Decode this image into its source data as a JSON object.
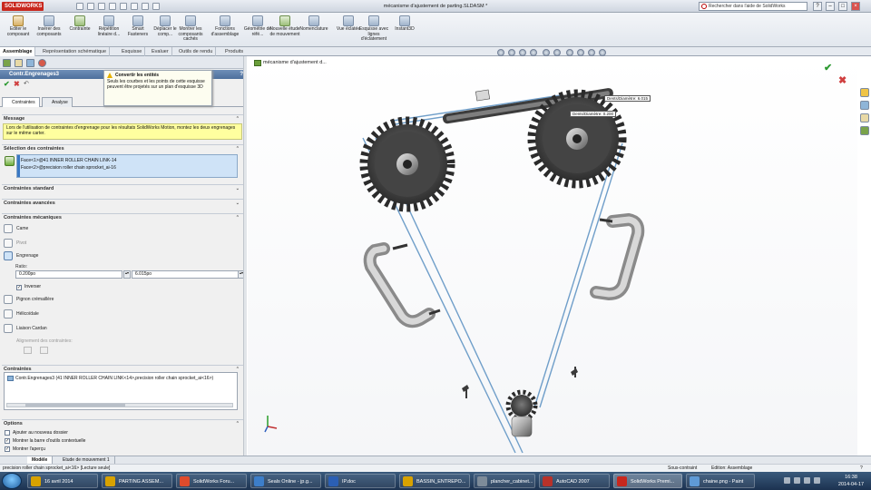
{
  "app": {
    "logo": "SOLIDWORKS",
    "window_title": "mécanisme d'ajustement de parting.SLDASM *",
    "help_search_placeholder": "Rechercher dans l'aide de SolidWorks"
  },
  "command_manager": {
    "buttons": [
      {
        "label": "Editer le composant",
        "icon": "edit-component-icon"
      },
      {
        "label": "Insérer des composants",
        "icon": "insert-components-icon"
      },
      {
        "label": "Contrainte",
        "icon": "mate-icon"
      },
      {
        "label": "Répétition linéaire d...",
        "icon": "linear-pattern-icon"
      },
      {
        "label": "Smart Fasteners",
        "icon": "smart-fasteners-icon"
      },
      {
        "label": "Déplacer le comp...",
        "icon": "move-component-icon"
      },
      {
        "label": "Montrer les composants cachés",
        "icon": "show-hidden-icon"
      },
      {
        "label": "Fonctions d'assemblage",
        "icon": "assembly-features-icon"
      },
      {
        "label": "Géométrie de réfé...",
        "icon": "reference-geometry-icon"
      },
      {
        "label": "Nouvelle étude de mouvement",
        "icon": "motion-study-icon"
      },
      {
        "label": "Nomenclature",
        "icon": "bom-icon"
      },
      {
        "label": "Vue éclatée",
        "icon": "exploded-view-icon"
      },
      {
        "label": "Esquisse avec lignes d'éclatement",
        "icon": "explode-line-icon"
      },
      {
        "label": "Instant3D",
        "icon": "instant3d-icon"
      }
    ]
  },
  "tabs": [
    "Assemblage",
    "Représentation schématique",
    "Esquisse",
    "Evaluer",
    "Outils de rendu",
    "Produits Office"
  ],
  "property_manager": {
    "title": "Contr.Engrenages3",
    "help": "?",
    "subtabs": [
      "Contraintes",
      "Analyse"
    ],
    "message_header": "Message",
    "message_text": "Lors de l'utilisation de contraintes d'engrenage pour les résultats SolidWorks Motion, montez les deux engrenages sur le même carter.",
    "selection_header": "Sélection des contraintes",
    "selections": [
      "Face<1>@41 INNER ROLLER CHAIN LINK-14",
      "Face<2>@precision roller chain sprocket_ai-16"
    ],
    "standard_header": "Contraintes standard",
    "advanced_header": "Contraintes avancées",
    "mechanical_header": "Contraintes mécaniques",
    "mechanical_items": [
      {
        "label": "Came",
        "icon": "cam-icon"
      },
      {
        "label": "Pivot",
        "icon": "hinge-icon"
      },
      {
        "label": "Engrenage",
        "icon": "gear-icon"
      }
    ],
    "ratio_label": "Ratio:",
    "ratio_value1": "0.200po",
    "ratio_value2": "6.015po",
    "reverse_label": "Inverser",
    "reverse_checked": true,
    "mechanical_items2": [
      {
        "label": "Pignon crémaillère",
        "icon": "rack-pinion-icon"
      },
      {
        "label": "Hélicoïdale",
        "icon": "screw-icon"
      },
      {
        "label": "Liaison Cardan",
        "icon": "universal-joint-icon"
      }
    ],
    "alignment_label": "Alignement des contraintes:",
    "mates_header": "Contraintes",
    "mates_item": "Contr.Engrenages3 (41 INNER ROLLER CHAIN LINK<14>,precision roller chain sprocket_ai<16>)",
    "options_header": "Options",
    "options": [
      {
        "label": "Ajouter au nouveau dossier",
        "checked": false
      },
      {
        "label": "Montrer la barre d'outils contextuelle",
        "checked": true
      },
      {
        "label": "Montrer l'aperçu",
        "checked": true
      }
    ]
  },
  "tooltip": {
    "title": "Convertir les entités",
    "text": "Seuls les courbes et les points de cette esquisse peuvent être projetés sur un plan d'esquisse 3D"
  },
  "viewport": {
    "tree_label": "mécanisme d'ajustement d...",
    "dim_labels": [
      "Dents/Diamètre: 6.015",
      "Dents/Diamètre: 0.200"
    ]
  },
  "bottom_tabs": [
    "Modèle",
    "Etude de mouvement 1"
  ],
  "status": {
    "left": "precision roller chain sprocket_ai<16> [Lecture seule]",
    "state": "Sous-contraint",
    "mode": "Edition: Assemblage",
    "help": "?"
  },
  "taskbar": {
    "items": [
      {
        "label": "16 avril 2014",
        "color": "#d8a200"
      },
      {
        "label": "PARTING ASSEM...",
        "color": "#d8a200"
      },
      {
        "label": "SolidWorks Foru...",
        "color": "#e04b2c"
      },
      {
        "label": "Seals Online - jp.g...",
        "color": "#3d7ec9"
      },
      {
        "label": "IP.doc",
        "color": "#2b5fb4"
      },
      {
        "label": "BASSIN_ENTREPO...",
        "color": "#d8a200"
      },
      {
        "label": "plancher_cabinet...",
        "color": "#7d8b99"
      },
      {
        "label": "AutoCAD 2007",
        "color": "#b8322a"
      },
      {
        "label": "SolidWorks Premi...",
        "color": "#c8281e"
      },
      {
        "label": "chaine.png - Paint",
        "color": "#5f9ad6"
      }
    ],
    "time": "16:38",
    "date": "2014-04-17"
  }
}
